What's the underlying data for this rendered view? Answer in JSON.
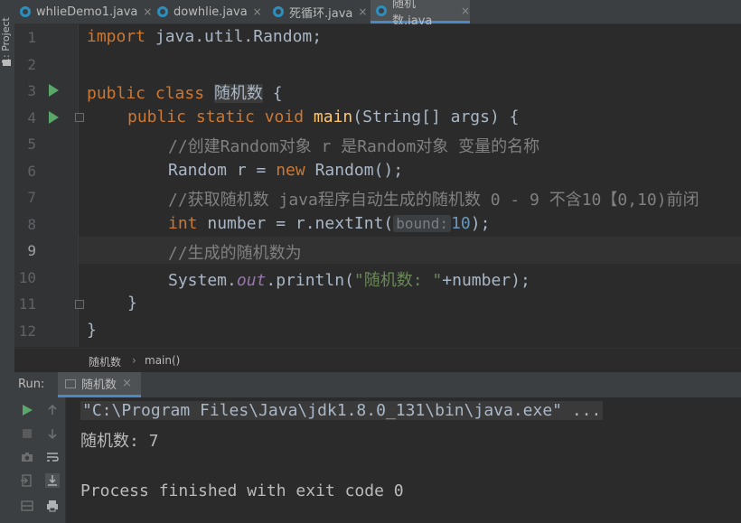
{
  "sidebar": {
    "project_label": "1: Project"
  },
  "tabs": [
    {
      "label": "whlieDemo1.java",
      "active": false
    },
    {
      "label": "dowhlie.java",
      "active": false
    },
    {
      "label": "死循环.java",
      "active": false
    },
    {
      "label": "随机数.java",
      "active": true
    }
  ],
  "editor": {
    "line_numbers": [
      "1",
      "2",
      "3",
      "4",
      "5",
      "6",
      "7",
      "8",
      "9",
      "10",
      "11",
      "12"
    ],
    "current_line": "9",
    "code": {
      "l1_import": "import",
      "l1_rest": " java.util.Random;",
      "l3_public": "public",
      "l3_class": " class ",
      "l3_name": "随机数",
      "l3_brace": " {",
      "l4_mods": "public static void",
      "l4_main": " main",
      "l4_params": "(String[] args) {",
      "l5_comment": "//创建Random对象 r 是Random对象 变量的名称",
      "l6_decl": "Random r = ",
      "l6_new": "new",
      "l6_rest": " Random();",
      "l7_comment": "//获取随机数 java程序自动生成的随机数 0 - 9 不含10【0,10)前闭",
      "l8_int": "int",
      "l8_mid": " number = r.nextInt(",
      "l8_hint": "bound:",
      "l8_num": "10",
      "l8_end": ");",
      "l9_comment": "//生成的随机数为",
      "l10_system": "System.",
      "l10_out": "out",
      "l10_println": ".println(",
      "l10_str": "\"随机数: \"",
      "l10_end": "+number);",
      "l11_brace": "}",
      "l12_brace": "}"
    }
  },
  "breadcrumb": {
    "class_name": "随机数",
    "separator": "›",
    "method": "main()"
  },
  "run_panel": {
    "label": "Run:",
    "tab_label": "随机数",
    "console_lines": [
      "\"C:\\Program Files\\Java\\jdk1.8.0_131\\bin\\java.exe\" ...",
      "随机数: 7",
      "",
      "Process finished with exit code 0"
    ]
  },
  "colors": {
    "background": "#2b2b2b",
    "keyword": "#cc7832",
    "method": "#ffc66d",
    "comment": "#808080",
    "string": "#6a8759",
    "number": "#6897bb",
    "field": "#9876aa",
    "run_green": "#59a869",
    "accent": "#4a88c7"
  }
}
